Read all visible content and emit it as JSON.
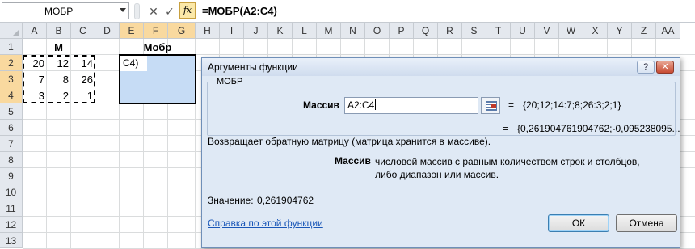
{
  "formula_bar": {
    "name_box": "МОБР",
    "cancel_glyph": "✕",
    "confirm_glyph": "✓",
    "fx_label": "fx",
    "formula": "=МОБР(A2:C4)"
  },
  "grid": {
    "columns": [
      "A",
      "B",
      "C",
      "D",
      "E",
      "F",
      "G",
      "H",
      "I",
      "J",
      "K",
      "L",
      "M",
      "N",
      "O",
      "P",
      "Q",
      "R",
      "S",
      "T",
      "U",
      "V",
      "W",
      "X",
      "Y",
      "Z",
      "AA"
    ],
    "rows": [
      "1",
      "2",
      "3",
      "4",
      "5",
      "6",
      "7",
      "8",
      "9",
      "10",
      "11",
      "12",
      "13"
    ],
    "title_m": "М",
    "title_mobr": "Мобр",
    "matrix": [
      [
        "20",
        "12",
        "14"
      ],
      [
        "7",
        "8",
        "26"
      ],
      [
        "3",
        "2",
        "1"
      ]
    ],
    "editing_cell_text": "C4)"
  },
  "dialog": {
    "title": "Аргументы функции",
    "help_glyph": "?",
    "close_glyph": "✕",
    "function_name": "МОБР",
    "arg_label": "Массив",
    "arg_input": "A2:C4",
    "arg_eq": "=",
    "arg_value": "{20;12;14:7;8;26:3;2;1}",
    "result_eq": "=",
    "result_preview": "{0,261904761904762;-0,095238095...",
    "description": "Возвращает обратную матрицу (матрица хранится в массиве).",
    "arg_desc_name": "Массив",
    "arg_desc_text": "числовой массив с равным количеством строк и столбцов, либо диапазон или массив.",
    "value_label": "Значение:",
    "value_result": "0,261904762",
    "help_link": "Справка по этой функции",
    "ok_label": "ОК",
    "cancel_label": "Отмена"
  },
  "colors": {
    "selection_fill": "#c6dcf5",
    "header_highlight": "#f9d99f",
    "dialog_bg": "#dfe9f5",
    "link": "#1a57b8"
  }
}
